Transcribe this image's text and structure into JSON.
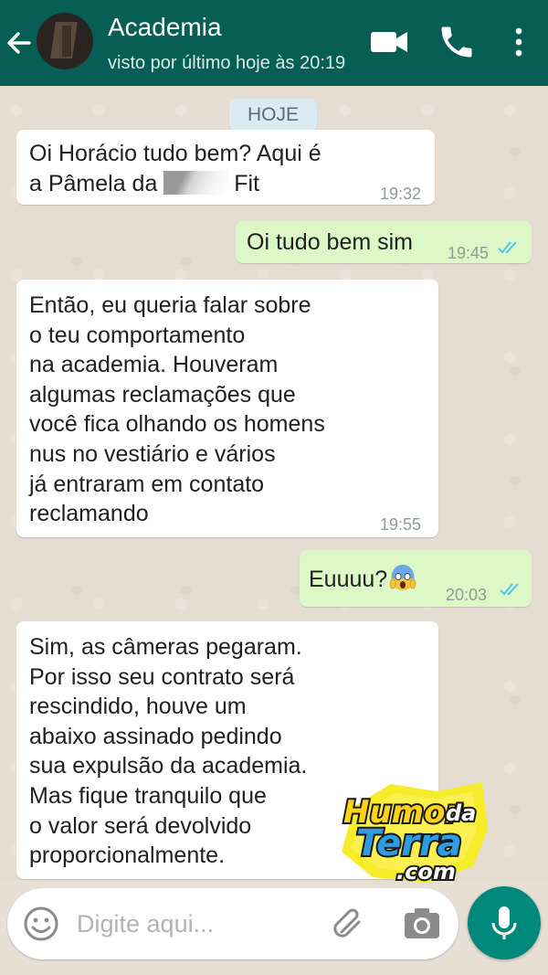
{
  "header": {
    "contact_name": "Academia",
    "last_seen": "visto por último hoje às 20:19",
    "icons": [
      "back-arrow-icon",
      "video-call-icon",
      "phone-icon",
      "more-vert-icon"
    ],
    "color": "#075e54"
  },
  "chat": {
    "date_chip": "HOJE",
    "messages": [
      {
        "direction": "in",
        "line1": "Oi Horácio tudo bem? Aqui é",
        "line2_pre": "a Pâmela da ",
        "line2_post": " Fit",
        "time": "19:32"
      },
      {
        "direction": "out",
        "text": "Oi tudo bem sim",
        "time": "19:45",
        "status": "read"
      },
      {
        "direction": "in",
        "text": "Então, eu queria falar sobre\no teu comportamento\nna academia. Houveram\nalgumas reclamações que\nvocê fica olhando os homens\nnus no vestiário e vários\njá entraram em contato\nreclamando",
        "time": "19:55"
      },
      {
        "direction": "out",
        "text": "Euuuu?",
        "emoji": "screaming-face-emoji",
        "time": "20:03",
        "status": "read"
      },
      {
        "direction": "in",
        "text": "Sim, as câmeras pegaram.\nPor isso seu contrato será\nrescindido, houve um\nabaixo assinado pedindo\nsua expulsão da academia.\nMas fique tranquilo que\no valor será devolvido\nproporcionalmente."
      }
    ],
    "incoming_bubble_color": "#ffffff",
    "outgoing_bubble_color": "#dcf8c6",
    "read_tick_color": "#4fc3f7"
  },
  "composer": {
    "placeholder": "Digite aqui...",
    "icons": [
      "emoji-icon",
      "attach-icon",
      "camera-icon",
      "mic-icon"
    ]
  },
  "watermark": {
    "text": "HumordaTerra.com",
    "line1_a": "Humor",
    "line1_b": "da",
    "line2": "Terra",
    "line3": ".com"
  }
}
